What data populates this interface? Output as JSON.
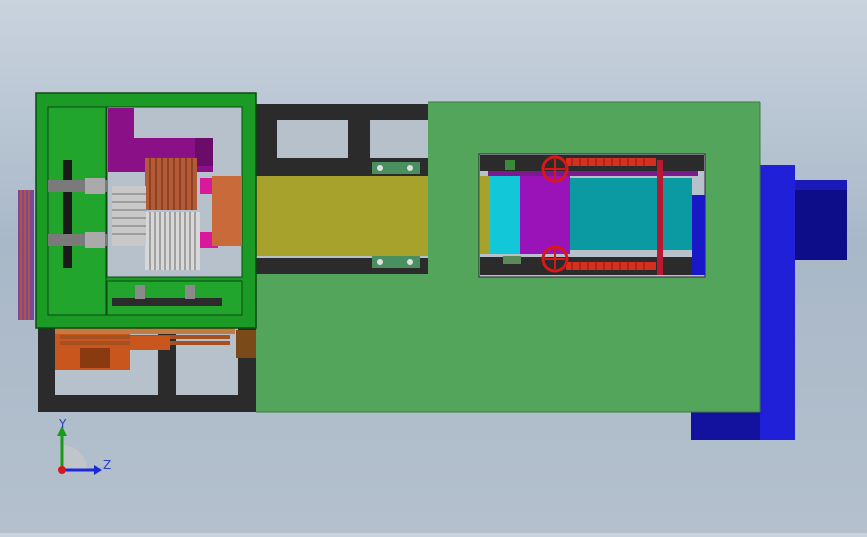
{
  "triad": {
    "y_label": "Y",
    "z_label": "Z"
  },
  "colors": {
    "background_top": "#c9d3de",
    "background_bottom": "#a9b8c8",
    "panel_green": "#52a55a",
    "gearbox_green": "#1c9a26",
    "frame_dark": "#2c2c2c",
    "rail_olive": "#a7a22b",
    "motor_blue": "#1818c8",
    "magenta": "#aa1d9e",
    "cyan": "#0fa0b4",
    "red": "#c81818"
  },
  "icons": [
    "coordinate-triad-icon"
  ]
}
